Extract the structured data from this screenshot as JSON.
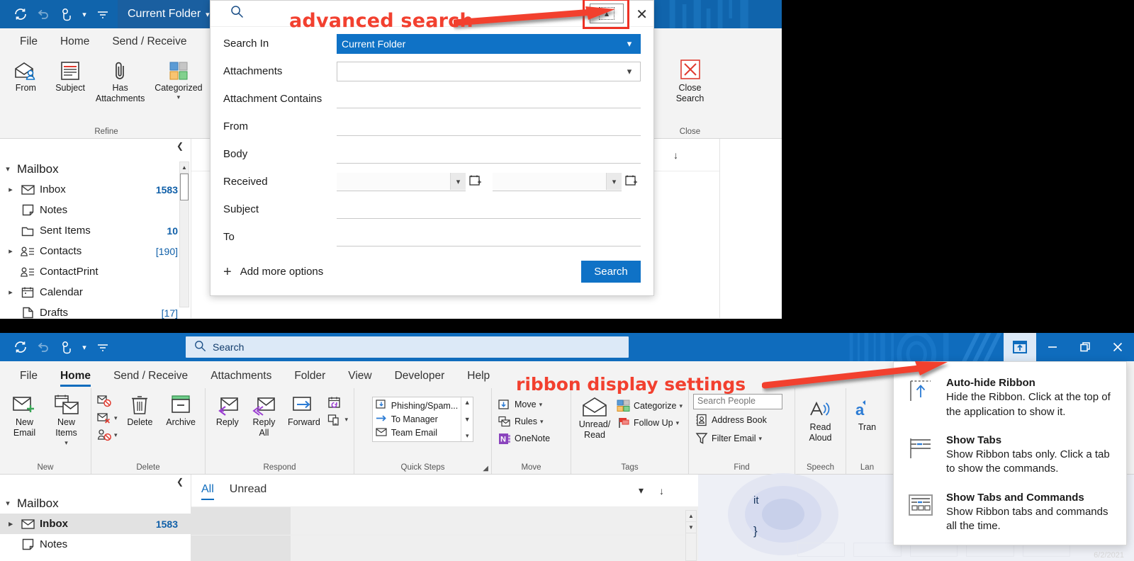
{
  "annotations": [
    {
      "id": "advanced-search",
      "text": "advanced search"
    },
    {
      "id": "ribbon-display-settings",
      "text": "ribbon display settings"
    }
  ],
  "colors": {
    "accent": "#0f6cbd",
    "title_top": "#1064ac",
    "annotation_red": "#f2402f",
    "count_blue": "#0f5fa8",
    "selected_blue": "#0f72c6"
  },
  "top_window": {
    "titlebar": {
      "quick_access": [
        {
          "name": "send-receive-all-folders-icon",
          "label": "Send/Receive All Folders"
        },
        {
          "name": "undo-icon",
          "label": "Undo"
        },
        {
          "name": "touch-mode-icon",
          "label": "Touch/Mouse Mode"
        },
        {
          "name": "customize-qat-icon",
          "label": "Customize Quick Access Toolbar"
        }
      ],
      "scope_label": "Current Folder"
    },
    "tabs": [
      {
        "label": "File",
        "active": false
      },
      {
        "label": "Home",
        "active": false
      },
      {
        "label": "Send / Receive",
        "active": false
      }
    ],
    "ribbon_groups": [
      {
        "label": "Refine",
        "buttons": [
          {
            "label": "From",
            "icon": "from-icon"
          },
          {
            "label": "Subject",
            "icon": "subject-icon"
          },
          {
            "label": "Has Attachments",
            "icon": "paperclip-icon"
          },
          {
            "label": "Categorized",
            "icon": "categorize-icon",
            "has_chevron": true
          }
        ]
      },
      {
        "label": "Close",
        "buttons": [
          {
            "label": "Close Search",
            "icon": "close-search-icon"
          }
        ]
      }
    ],
    "folder_pane": {
      "collapse_icon": "collapse-pane-icon",
      "root": "Mailbox",
      "items": [
        {
          "label": "Inbox",
          "count": "1583",
          "icon": "inbox-icon",
          "expandable": true,
          "bracketed": false
        },
        {
          "label": "Notes",
          "count": "",
          "icon": "notes-icon",
          "expandable": false,
          "bracketed": false
        },
        {
          "label": "Sent Items",
          "count": "10",
          "icon": "folder-icon",
          "expandable": false,
          "bracketed": false
        },
        {
          "label": "Contacts",
          "count": "[190]",
          "icon": "contacts-icon",
          "expandable": true,
          "bracketed": true
        },
        {
          "label": "ContactPrint",
          "count": "",
          "icon": "contacts-icon",
          "expandable": false,
          "bracketed": false
        },
        {
          "label": "Calendar",
          "count": "",
          "icon": "calendar-icon",
          "expandable": true,
          "bracketed": false
        },
        {
          "label": "Drafts",
          "count": "[17]",
          "icon": "drafts-icon",
          "expandable": false,
          "bracketed": true
        }
      ]
    },
    "list_header": {
      "arrange_icon": "chevron-down-icon",
      "sort_icon": "sort-arrow-icon"
    },
    "advanced_search": {
      "search_icon": "search-icon",
      "collapse_button_icon": "chevron-up-icon",
      "close_icon": "close-icon",
      "rows": [
        {
          "label": "Search In",
          "type": "combo",
          "value": "Current Folder",
          "selected": true
        },
        {
          "label": "Attachments",
          "type": "combo",
          "value": "",
          "selected": false
        },
        {
          "label": "Attachment Contains",
          "type": "line",
          "value": ""
        },
        {
          "label": "From",
          "type": "line",
          "value": ""
        },
        {
          "label": "Body",
          "type": "line",
          "value": ""
        },
        {
          "label": "Received",
          "type": "daterange",
          "value_from": "",
          "value_to": ""
        },
        {
          "label": "Subject",
          "type": "line",
          "value": ""
        },
        {
          "label": "To",
          "type": "line",
          "value": ""
        }
      ],
      "add_more_label": "Add more options",
      "add_more_icon": "plus-icon",
      "search_button": "Search"
    }
  },
  "bottom_window": {
    "titlebar": {
      "quick_access": [
        {
          "name": "send-receive-all-folders-icon",
          "label": "Send/Receive All Folders"
        },
        {
          "name": "undo-icon",
          "label": "Undo"
        },
        {
          "name": "touch-mode-icon",
          "label": "Touch/Mouse Mode"
        },
        {
          "name": "customize-qat-icon",
          "label": "Customize Quick Access Toolbar"
        }
      ],
      "search_placeholder": "Search",
      "search_icon": "search-icon",
      "controls": [
        {
          "name": "ribbon-display-options-button",
          "icon": "ribbon-display-icon",
          "active": true
        },
        {
          "name": "minimize-button",
          "icon": "minimize-icon",
          "active": false
        },
        {
          "name": "restore-button",
          "icon": "restore-icon",
          "active": false
        },
        {
          "name": "close-button",
          "icon": "close-icon",
          "active": false
        }
      ]
    },
    "tabs": [
      {
        "label": "File",
        "active": false
      },
      {
        "label": "Home",
        "active": true
      },
      {
        "label": "Send / Receive",
        "active": false
      },
      {
        "label": "Attachments",
        "active": false
      },
      {
        "label": "Folder",
        "active": false
      },
      {
        "label": "View",
        "active": false
      },
      {
        "label": "Developer",
        "active": false
      },
      {
        "label": "Help",
        "active": false
      }
    ],
    "ribbon": {
      "groups": [
        {
          "label": "New",
          "type": "big",
          "buttons": [
            {
              "label": "New Email",
              "icon": "new-email-icon"
            },
            {
              "label": "New Items",
              "icon": "new-items-icon",
              "has_chevron": true
            }
          ]
        },
        {
          "label": "Delete",
          "type": "mixed",
          "small": [
            {
              "label": "",
              "icon": "ignore-icon",
              "has_chevron": false
            },
            {
              "label": "",
              "icon": "clean-up-icon",
              "has_chevron": true
            },
            {
              "label": "",
              "icon": "junk-icon",
              "has_chevron": true
            }
          ],
          "buttons": [
            {
              "label": "Delete",
              "icon": "delete-icon"
            },
            {
              "label": "Archive",
              "icon": "archive-icon"
            }
          ]
        },
        {
          "label": "Respond",
          "type": "big",
          "buttons": [
            {
              "label": "Reply",
              "icon": "reply-icon"
            },
            {
              "label": "Reply All",
              "icon": "reply-all-icon"
            },
            {
              "label": "Forward",
              "icon": "forward-icon"
            }
          ],
          "small": [
            {
              "label": "",
              "icon": "meeting-icon",
              "has_chevron": false
            },
            {
              "label": "",
              "icon": "more-respond-icon",
              "has_chevron": true
            }
          ]
        },
        {
          "label": "Quick Steps",
          "type": "gallery",
          "items": [
            {
              "label": "Phishing/Spam...",
              "icon": "move-to-folder-icon"
            },
            {
              "label": "To Manager",
              "icon": "forward-arrow-icon"
            },
            {
              "label": "Team Email",
              "icon": "email-icon"
            }
          ],
          "scroll_icons": [
            "chevron-up-icon",
            "chevron-down-icon",
            "more-icon"
          ],
          "dialog_launcher_icon": "dialog-launcher-icon"
        },
        {
          "label": "Move",
          "type": "small",
          "small": [
            {
              "label": "Move",
              "icon": "move-icon",
              "has_chevron": true
            },
            {
              "label": "Rules",
              "icon": "rules-icon",
              "has_chevron": true
            },
            {
              "label": "OneNote",
              "icon": "onenote-icon",
              "has_chevron": false
            }
          ]
        },
        {
          "label": "Tags",
          "type": "mixed",
          "buttons": [
            {
              "label": "Unread/ Read",
              "icon": "unread-read-icon"
            }
          ],
          "small": [
            {
              "label": "Categorize",
              "icon": "categorize-icon",
              "has_chevron": true
            },
            {
              "label": "Follow Up",
              "icon": "follow-up-icon",
              "has_chevron": true
            }
          ]
        },
        {
          "label": "Find",
          "type": "find",
          "search_people_placeholder": "Search People",
          "small": [
            {
              "label": "Address Book",
              "icon": "address-book-icon",
              "has_chevron": false
            },
            {
              "label": "Filter Email",
              "icon": "filter-icon",
              "has_chevron": true
            }
          ]
        },
        {
          "label": "Speech",
          "type": "big",
          "buttons": [
            {
              "label": "Read Aloud",
              "icon": "read-aloud-icon"
            }
          ]
        },
        {
          "label": "Lan",
          "type": "big",
          "buttons": [
            {
              "label": "Tran",
              "icon": "translate-icon"
            }
          ]
        }
      ]
    },
    "folder_pane": {
      "collapse_icon": "collapse-pane-icon",
      "root": "Mailbox",
      "items": [
        {
          "label": "Inbox",
          "count": "1583",
          "icon": "inbox-icon",
          "expandable": true,
          "selected": true
        },
        {
          "label": "Notes",
          "count": "",
          "icon": "notes-icon",
          "expandable": false,
          "selected": false
        }
      ]
    },
    "list_header": {
      "tabs": [
        {
          "label": "All",
          "active": true
        },
        {
          "label": "Unread",
          "active": false
        }
      ],
      "arrange_icon": "chevron-down-icon",
      "sort_icon": "sort-arrow-icon"
    },
    "reading_pane": {
      "snippet_1": "it",
      "snippet_2": "}",
      "date": "6/2/2021"
    },
    "ribbon_display_menu": {
      "items": [
        {
          "title": "Auto-hide Ribbon",
          "underline_char": "A",
          "description": "Hide the Ribbon. Click at the top of the application to show it.",
          "icon": "auto-hide-ribbon-icon"
        },
        {
          "title": "Show Tabs",
          "underline_char": "b",
          "description": "Show Ribbon tabs only. Click a tab to show the commands.",
          "icon": "show-tabs-icon"
        },
        {
          "title": "Show Tabs and Commands",
          "underline_char": "o",
          "description": "Show Ribbon tabs and commands all the time.",
          "icon": "show-tabs-commands-icon"
        }
      ]
    }
  }
}
